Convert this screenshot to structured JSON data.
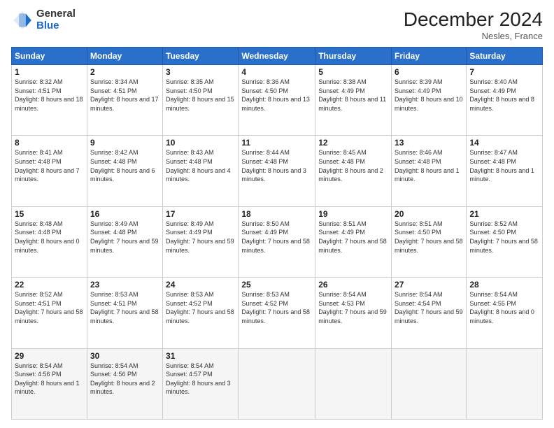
{
  "header": {
    "logo_general": "General",
    "logo_blue": "Blue",
    "title": "December 2024",
    "location": "Nesles, France"
  },
  "days_of_week": [
    "Sunday",
    "Monday",
    "Tuesday",
    "Wednesday",
    "Thursday",
    "Friday",
    "Saturday"
  ],
  "weeks": [
    [
      {
        "day": "1",
        "sunrise": "8:32 AM",
        "sunset": "4:51 PM",
        "daylight": "8 hours and 18 minutes."
      },
      {
        "day": "2",
        "sunrise": "8:34 AM",
        "sunset": "4:51 PM",
        "daylight": "8 hours and 17 minutes."
      },
      {
        "day": "3",
        "sunrise": "8:35 AM",
        "sunset": "4:50 PM",
        "daylight": "8 hours and 15 minutes."
      },
      {
        "day": "4",
        "sunrise": "8:36 AM",
        "sunset": "4:50 PM",
        "daylight": "8 hours and 13 minutes."
      },
      {
        "day": "5",
        "sunrise": "8:38 AM",
        "sunset": "4:49 PM",
        "daylight": "8 hours and 11 minutes."
      },
      {
        "day": "6",
        "sunrise": "8:39 AM",
        "sunset": "4:49 PM",
        "daylight": "8 hours and 10 minutes."
      },
      {
        "day": "7",
        "sunrise": "8:40 AM",
        "sunset": "4:49 PM",
        "daylight": "8 hours and 8 minutes."
      }
    ],
    [
      {
        "day": "8",
        "sunrise": "8:41 AM",
        "sunset": "4:48 PM",
        "daylight": "8 hours and 7 minutes."
      },
      {
        "day": "9",
        "sunrise": "8:42 AM",
        "sunset": "4:48 PM",
        "daylight": "8 hours and 6 minutes."
      },
      {
        "day": "10",
        "sunrise": "8:43 AM",
        "sunset": "4:48 PM",
        "daylight": "8 hours and 4 minutes."
      },
      {
        "day": "11",
        "sunrise": "8:44 AM",
        "sunset": "4:48 PM",
        "daylight": "8 hours and 3 minutes."
      },
      {
        "day": "12",
        "sunrise": "8:45 AM",
        "sunset": "4:48 PM",
        "daylight": "8 hours and 2 minutes."
      },
      {
        "day": "13",
        "sunrise": "8:46 AM",
        "sunset": "4:48 PM",
        "daylight": "8 hours and 1 minute."
      },
      {
        "day": "14",
        "sunrise": "8:47 AM",
        "sunset": "4:48 PM",
        "daylight": "8 hours and 1 minute."
      }
    ],
    [
      {
        "day": "15",
        "sunrise": "8:48 AM",
        "sunset": "4:48 PM",
        "daylight": "8 hours and 0 minutes."
      },
      {
        "day": "16",
        "sunrise": "8:49 AM",
        "sunset": "4:48 PM",
        "daylight": "7 hours and 59 minutes."
      },
      {
        "day": "17",
        "sunrise": "8:49 AM",
        "sunset": "4:49 PM",
        "daylight": "7 hours and 59 minutes."
      },
      {
        "day": "18",
        "sunrise": "8:50 AM",
        "sunset": "4:49 PM",
        "daylight": "7 hours and 58 minutes."
      },
      {
        "day": "19",
        "sunrise": "8:51 AM",
        "sunset": "4:49 PM",
        "daylight": "7 hours and 58 minutes."
      },
      {
        "day": "20",
        "sunrise": "8:51 AM",
        "sunset": "4:50 PM",
        "daylight": "7 hours and 58 minutes."
      },
      {
        "day": "21",
        "sunrise": "8:52 AM",
        "sunset": "4:50 PM",
        "daylight": "7 hours and 58 minutes."
      }
    ],
    [
      {
        "day": "22",
        "sunrise": "8:52 AM",
        "sunset": "4:51 PM",
        "daylight": "7 hours and 58 minutes."
      },
      {
        "day": "23",
        "sunrise": "8:53 AM",
        "sunset": "4:51 PM",
        "daylight": "7 hours and 58 minutes."
      },
      {
        "day": "24",
        "sunrise": "8:53 AM",
        "sunset": "4:52 PM",
        "daylight": "7 hours and 58 minutes."
      },
      {
        "day": "25",
        "sunrise": "8:53 AM",
        "sunset": "4:52 PM",
        "daylight": "7 hours and 58 minutes."
      },
      {
        "day": "26",
        "sunrise": "8:54 AM",
        "sunset": "4:53 PM",
        "daylight": "7 hours and 59 minutes."
      },
      {
        "day": "27",
        "sunrise": "8:54 AM",
        "sunset": "4:54 PM",
        "daylight": "7 hours and 59 minutes."
      },
      {
        "day": "28",
        "sunrise": "8:54 AM",
        "sunset": "4:55 PM",
        "daylight": "8 hours and 0 minutes."
      }
    ],
    [
      {
        "day": "29",
        "sunrise": "8:54 AM",
        "sunset": "4:56 PM",
        "daylight": "8 hours and 1 minute."
      },
      {
        "day": "30",
        "sunrise": "8:54 AM",
        "sunset": "4:56 PM",
        "daylight": "8 hours and 2 minutes."
      },
      {
        "day": "31",
        "sunrise": "8:54 AM",
        "sunset": "4:57 PM",
        "daylight": "8 hours and 3 minutes."
      },
      null,
      null,
      null,
      null
    ]
  ]
}
